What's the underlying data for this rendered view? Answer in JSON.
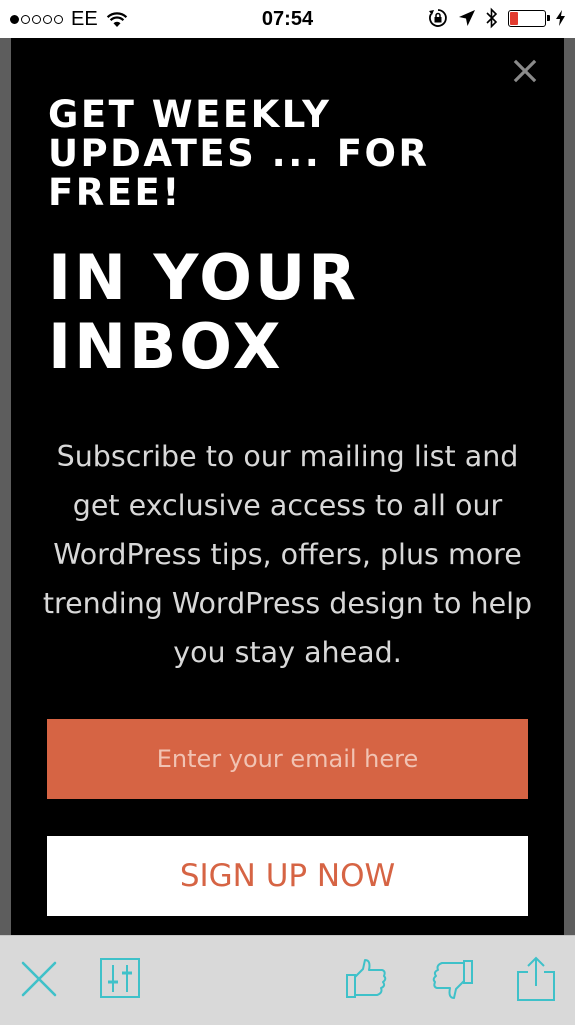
{
  "status_bar": {
    "carrier": "EE",
    "time": "07:54",
    "battery_level": 0.22,
    "signal_bars_filled": 1,
    "signal_bars_total": 5,
    "icons": [
      "wifi-icon",
      "rotation-lock-icon",
      "location-arrow-icon",
      "bluetooth-icon",
      "battery-icon",
      "charging-bolt-icon"
    ]
  },
  "modal": {
    "close_icon": "close-icon",
    "heading": "GET WEEKLY UPDATES ... FOR FREE!",
    "subheading": "IN YOUR INBOX",
    "description": "Subscribe to our mailing list and get exclusive access to all our WordPress tips, offers, plus more trending WordPress design to help you stay ahead.",
    "email_placeholder": "Enter your email here",
    "signup_label": "SIGN UP NOW"
  },
  "colors": {
    "accent": "#d66444",
    "icon_teal": "#3fc1c9",
    "battery_red": "#e23b2f"
  },
  "toolbar": {
    "icons": [
      "close-icon",
      "sliders-icon",
      "thumbs-up-icon",
      "thumbs-down-icon",
      "share-icon"
    ]
  }
}
